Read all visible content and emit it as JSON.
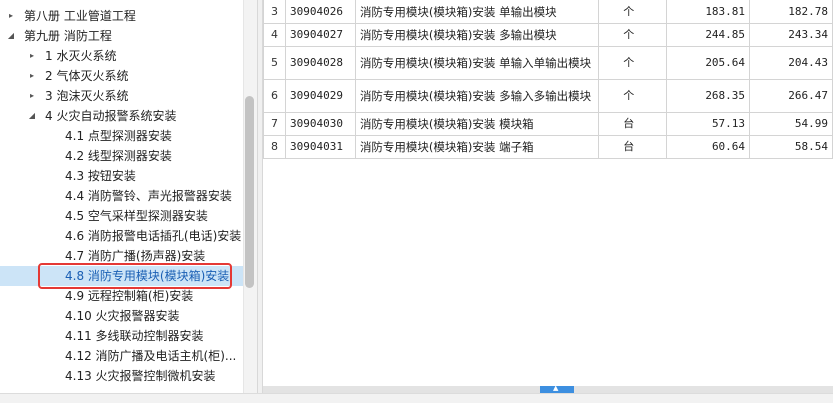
{
  "tree": {
    "items": [
      {
        "label": "第八册 工业管道工程",
        "arrow": "▸"
      },
      {
        "label": "第九册 消防工程",
        "arrow": "◢"
      },
      {
        "label": "1 水灭火系统",
        "arrow": "▸"
      },
      {
        "label": "2 气体灭火系统",
        "arrow": "▸"
      },
      {
        "label": "3 泡沫灭火系统",
        "arrow": "▸"
      },
      {
        "label": "4 火灾自动报警系统安装",
        "arrow": "◢"
      },
      {
        "label": "4.1 点型探测器安装",
        "arrow": ""
      },
      {
        "label": "4.2 线型探测器安装",
        "arrow": ""
      },
      {
        "label": "4.3 按钮安装",
        "arrow": ""
      },
      {
        "label": "4.4 消防警铃、声光报警器安装",
        "arrow": ""
      },
      {
        "label": "4.5 空气采样型探测器安装",
        "arrow": ""
      },
      {
        "label": "4.6 消防报警电话插孔(电话)安装",
        "arrow": ""
      },
      {
        "label": "4.7 消防广播(扬声器)安装",
        "arrow": ""
      },
      {
        "label": "4.8 消防专用模块(模块箱)安装",
        "arrow": ""
      },
      {
        "label": "4.9 远程控制箱(柜)安装",
        "arrow": ""
      },
      {
        "label": "4.10 火灾报警器安装",
        "arrow": ""
      },
      {
        "label": "4.11 多线联动控制器安装",
        "arrow": ""
      },
      {
        "label": "4.12 消防广播及电话主机(柜)...",
        "arrow": ""
      },
      {
        "label": "4.13 火灾报警控制微机安装",
        "arrow": ""
      }
    ]
  },
  "table": {
    "rows": [
      {
        "idx": "3",
        "code": "30904026",
        "name": "消防专用模块(模块箱)安装 单输出模块",
        "unit": "个",
        "v1": "183.81",
        "v2": "182.78"
      },
      {
        "idx": "4",
        "code": "30904027",
        "name": "消防专用模块(模块箱)安装 多输出模块",
        "unit": "个",
        "v1": "244.85",
        "v2": "243.34"
      },
      {
        "idx": "5",
        "code": "30904028",
        "name": "消防专用模块(模块箱)安装 单输入单输出模块",
        "unit": "个",
        "v1": "205.64",
        "v2": "204.43"
      },
      {
        "idx": "6",
        "code": "30904029",
        "name": "消防专用模块(模块箱)安装 多输入多输出模块",
        "unit": "个",
        "v1": "268.35",
        "v2": "266.47"
      },
      {
        "idx": "7",
        "code": "30904030",
        "name": "消防专用模块(模块箱)安装 模块箱",
        "unit": "台",
        "v1": "57.13",
        "v2": "54.99"
      },
      {
        "idx": "8",
        "code": "30904031",
        "name": "消防专用模块(模块箱)安装 端子箱",
        "unit": "台",
        "v1": "60.64",
        "v2": "58.54"
      }
    ]
  },
  "colors": {
    "selection": "#cce4f7",
    "highlight": "#e53935",
    "scroll_grip": "#3d8fe0"
  }
}
